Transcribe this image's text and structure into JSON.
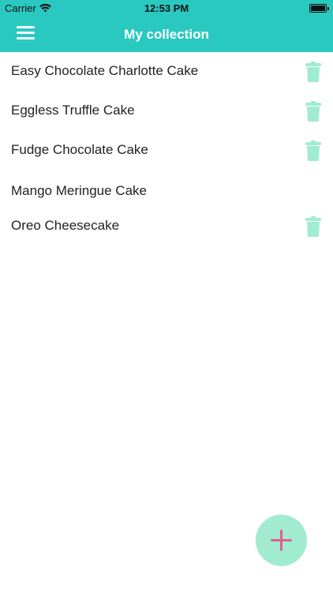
{
  "status_bar": {
    "carrier": "Carrier",
    "time": "12:53 PM"
  },
  "nav": {
    "title": "My collection",
    "menu_icon": "hamburger-menu-icon"
  },
  "recipes": [
    {
      "name": "Easy Chocolate Charlotte Cake",
      "deletable": true
    },
    {
      "name": "Eggless Truffle Cake",
      "deletable": true
    },
    {
      "name": "Fudge Chocolate Cake",
      "deletable": true
    },
    {
      "name": "Mango Meringue Cake",
      "deletable": false
    },
    {
      "name": "Oreo Cheesecake",
      "deletable": true
    }
  ],
  "fab": {
    "icon": "plus-icon"
  },
  "colors": {
    "header": "#2ac9c0",
    "trash": "#a1ecd1",
    "fab_background": "#a1ecd1",
    "fab_plus": "#e45c92"
  }
}
